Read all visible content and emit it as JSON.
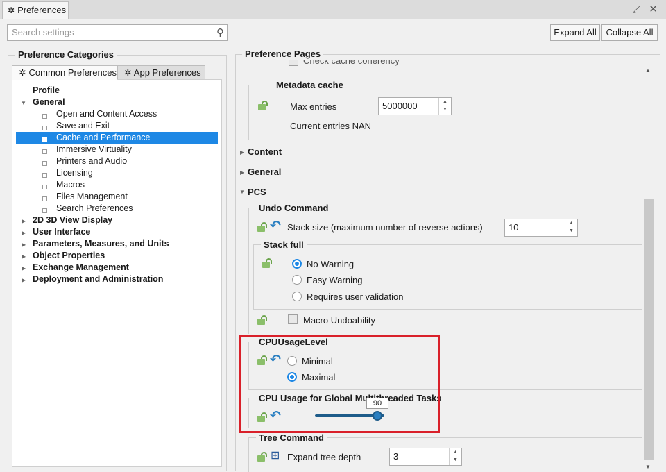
{
  "window": {
    "tab_label": "Preferences",
    "controls": "⤢ ✕"
  },
  "search": {
    "placeholder": "Search settings"
  },
  "toolbar": {
    "expand_all": "Expand All",
    "collapse_all": "Collapse All"
  },
  "left": {
    "title": "Preference Categories",
    "tabs": [
      {
        "label": "Common Preferences",
        "icon": "gear-icon"
      },
      {
        "label": "App Preferences",
        "icon": "gear-icon"
      }
    ],
    "tree": {
      "profile": "Profile",
      "general": "General",
      "general_children": [
        "Open and Content Access",
        "Save and Exit",
        "Cache and Performance",
        "Immersive Virtuality",
        "Printers and Audio",
        "Licensing",
        "Macros",
        "Files Management",
        "Search Preferences"
      ],
      "selected": "Cache and Performance",
      "collapsed": [
        "2D 3D View Display",
        "User Interface",
        "Parameters, Measures, and Units",
        "Object Properties",
        "Exchange Management",
        "Deployment and Administration"
      ]
    }
  },
  "right": {
    "title": "Preference Pages",
    "top_cut_text": "Check cache coherency",
    "metadata": {
      "title": "Metadata cache",
      "max_entries_label": "Max entries",
      "max_entries_value": "5000000",
      "current_entries": "Current entries  NAN"
    },
    "sections": [
      "Content",
      "General",
      "PCS"
    ],
    "undo": {
      "title": "Undo Command",
      "stack_label": "Stack size (maximum number of reverse actions)",
      "stack_value": "10"
    },
    "stack_full": {
      "title": "Stack full",
      "options": [
        "No Warning",
        "Easy Warning",
        "Requires user validation"
      ],
      "selected": "No Warning"
    },
    "macro_undo": "Macro Undoability",
    "cpu_level": {
      "title": "CPUUsageLevel",
      "options": [
        "Minimal",
        "Maximal"
      ],
      "selected": "Maximal"
    },
    "cpu_mt": {
      "title": "CPU Usage for Global Multithreaded Tasks",
      "value": "90",
      "fraction": 0.9
    },
    "tree_cmd": {
      "title": "Tree Command",
      "label": "Expand tree depth",
      "value": "3"
    }
  },
  "colors": {
    "accent": "#1e88e5",
    "highlight_box": "#d9202a"
  }
}
